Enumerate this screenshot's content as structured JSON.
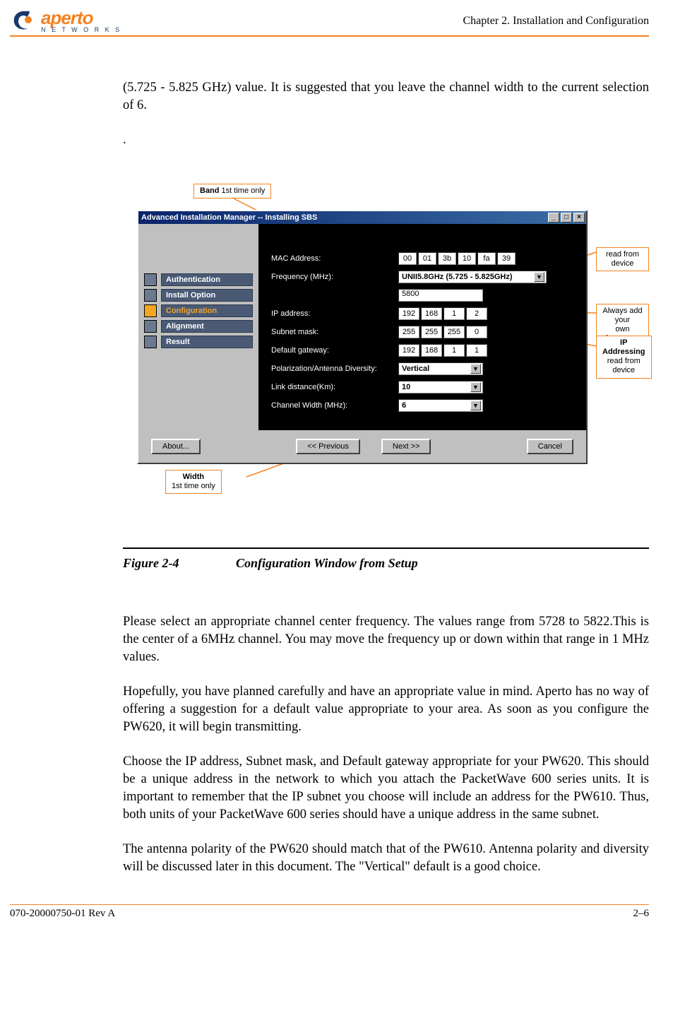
{
  "header": {
    "logo_word": "aperto",
    "logo_sub": "N E T W O R K S",
    "chapter": "Chapter 2.  Installation and Configuration"
  },
  "intro": "(5.725 - 5.825 GHz) value. It is suggested that you leave the channel width to the current selection of 6.",
  "dot": ".",
  "callouts": {
    "band_bold": "Band",
    "band_rest": " 1st time only",
    "read_device": "read from device",
    "freq_line1": "Always add your",
    "freq_line2": "own frequency",
    "ip_bold": "IP Addressing",
    "ip_rest": "read from device",
    "width_bold": "Width",
    "width_rest": " 1st time only"
  },
  "window": {
    "title": "Advanced Installation Manager -- Installing SBS",
    "min": "_",
    "max": "□",
    "close": "×",
    "sidebar": [
      {
        "label": "Authentication",
        "active": false
      },
      {
        "label": "Install Option",
        "active": false
      },
      {
        "label": "Configuration",
        "active": true
      },
      {
        "label": "Alignment",
        "active": false
      },
      {
        "label": "Result",
        "active": false
      }
    ],
    "fields": {
      "mac_label": "MAC Address:",
      "mac": [
        "00",
        "01",
        "3b",
        "10",
        "fa",
        "39"
      ],
      "freq_label": "Frequency (MHz):",
      "freq_dd": "UNII5.8GHz (5.725 - 5.825GHz)",
      "freq_val": "5800",
      "ip_label": "IP address:",
      "ip": [
        "192",
        "168",
        "1",
        "2"
      ],
      "subnet_label": "Subnet mask:",
      "subnet": [
        "255",
        "255",
        "255",
        "0"
      ],
      "gw_label": "Default gateway:",
      "gw": [
        "192",
        "168",
        "1",
        "1"
      ],
      "pol_label": "Polarization/Antenna Diversity:",
      "pol_val": "Vertical",
      "link_label": "Link distance(Km):",
      "link_val": "10",
      "cw_label": "Channel Width (MHz):",
      "cw_val": "6"
    },
    "buttons": {
      "about": "About...",
      "prev": "<< Previous",
      "next": "Next >>",
      "cancel": "Cancel"
    }
  },
  "figure": {
    "num": "Figure 2-4",
    "title": "Configuration Window from Setup"
  },
  "paras": [
    "Please select an appropriate channel center frequency. The values range from 5728 to 5822.This is the center of a 6MHz channel. You may move the frequency  up or down within that range in 1 MHz values.",
    "Hopefully, you have planned carefully and have an appropriate value in mind. Aperto has no way of offering a suggestion for a default value appropriate to your area. As soon as you configure the PW620, it will begin transmitting.",
    "Choose the IP address, Subnet mask, and Default gateway appropriate for your PW620. This should be a unique address in the network to which you attach the PacketWave 600 series units. It is important to remember that the IP subnet you choose will include an address for the PW610. Thus, both units of your PacketWave 600 series should have a unique address in the same subnet.",
    "The antenna polarity of the PW620 should match that of the PW610. Antenna polarity and diversity will be discussed later in this document. The \"Vertical\" default is a good choice."
  ],
  "footer": {
    "left": "070-20000750-01 Rev A",
    "right": "2–6"
  }
}
